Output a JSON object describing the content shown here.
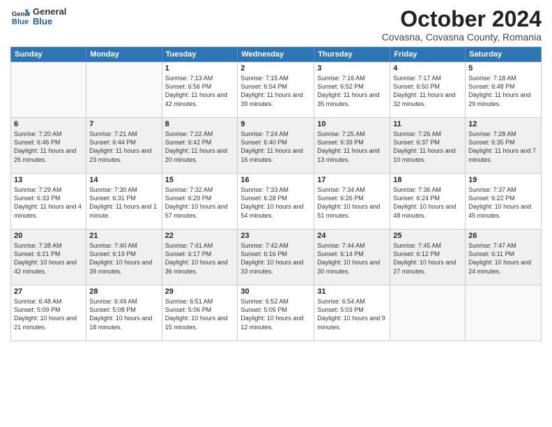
{
  "header": {
    "logo_general": "General",
    "logo_blue": "Blue",
    "month_title": "October 2024",
    "location": "Covasna, Covasna County, Romania"
  },
  "weekdays": [
    "Sunday",
    "Monday",
    "Tuesday",
    "Wednesday",
    "Thursday",
    "Friday",
    "Saturday"
  ],
  "weeks": [
    [
      {
        "day": "",
        "sunrise": "",
        "sunset": "",
        "daylight": ""
      },
      {
        "day": "",
        "sunrise": "",
        "sunset": "",
        "daylight": ""
      },
      {
        "day": "1",
        "sunrise": "Sunrise: 7:13 AM",
        "sunset": "Sunset: 6:56 PM",
        "daylight": "Daylight: 11 hours and 42 minutes."
      },
      {
        "day": "2",
        "sunrise": "Sunrise: 7:15 AM",
        "sunset": "Sunset: 6:54 PM",
        "daylight": "Daylight: 11 hours and 39 minutes."
      },
      {
        "day": "3",
        "sunrise": "Sunrise: 7:16 AM",
        "sunset": "Sunset: 6:52 PM",
        "daylight": "Daylight: 11 hours and 35 minutes."
      },
      {
        "day": "4",
        "sunrise": "Sunrise: 7:17 AM",
        "sunset": "Sunset: 6:50 PM",
        "daylight": "Daylight: 11 hours and 32 minutes."
      },
      {
        "day": "5",
        "sunrise": "Sunrise: 7:18 AM",
        "sunset": "Sunset: 6:48 PM",
        "daylight": "Daylight: 11 hours and 29 minutes."
      }
    ],
    [
      {
        "day": "6",
        "sunrise": "Sunrise: 7:20 AM",
        "sunset": "Sunset: 6:46 PM",
        "daylight": "Daylight: 11 hours and 26 minutes."
      },
      {
        "day": "7",
        "sunrise": "Sunrise: 7:21 AM",
        "sunset": "Sunset: 6:44 PM",
        "daylight": "Daylight: 11 hours and 23 minutes."
      },
      {
        "day": "8",
        "sunrise": "Sunrise: 7:22 AM",
        "sunset": "Sunset: 6:42 PM",
        "daylight": "Daylight: 11 hours and 20 minutes."
      },
      {
        "day": "9",
        "sunrise": "Sunrise: 7:24 AM",
        "sunset": "Sunset: 6:40 PM",
        "daylight": "Daylight: 11 hours and 16 minutes."
      },
      {
        "day": "10",
        "sunrise": "Sunrise: 7:25 AM",
        "sunset": "Sunset: 6:39 PM",
        "daylight": "Daylight: 11 hours and 13 minutes."
      },
      {
        "day": "11",
        "sunrise": "Sunrise: 7:26 AM",
        "sunset": "Sunset: 6:37 PM",
        "daylight": "Daylight: 11 hours and 10 minutes."
      },
      {
        "day": "12",
        "sunrise": "Sunrise: 7:28 AM",
        "sunset": "Sunset: 6:35 PM",
        "daylight": "Daylight: 11 hours and 7 minutes."
      }
    ],
    [
      {
        "day": "13",
        "sunrise": "Sunrise: 7:29 AM",
        "sunset": "Sunset: 6:33 PM",
        "daylight": "Daylight: 11 hours and 4 minutes."
      },
      {
        "day": "14",
        "sunrise": "Sunrise: 7:30 AM",
        "sunset": "Sunset: 6:31 PM",
        "daylight": "Daylight: 11 hours and 1 minute."
      },
      {
        "day": "15",
        "sunrise": "Sunrise: 7:32 AM",
        "sunset": "Sunset: 6:29 PM",
        "daylight": "Daylight: 10 hours and 57 minutes."
      },
      {
        "day": "16",
        "sunrise": "Sunrise: 7:33 AM",
        "sunset": "Sunset: 6:28 PM",
        "daylight": "Daylight: 10 hours and 54 minutes."
      },
      {
        "day": "17",
        "sunrise": "Sunrise: 7:34 AM",
        "sunset": "Sunset: 6:26 PM",
        "daylight": "Daylight: 10 hours and 51 minutes."
      },
      {
        "day": "18",
        "sunrise": "Sunrise: 7:36 AM",
        "sunset": "Sunset: 6:24 PM",
        "daylight": "Daylight: 10 hours and 48 minutes."
      },
      {
        "day": "19",
        "sunrise": "Sunrise: 7:37 AM",
        "sunset": "Sunset: 6:22 PM",
        "daylight": "Daylight: 10 hours and 45 minutes."
      }
    ],
    [
      {
        "day": "20",
        "sunrise": "Sunrise: 7:38 AM",
        "sunset": "Sunset: 6:21 PM",
        "daylight": "Daylight: 10 hours and 42 minutes."
      },
      {
        "day": "21",
        "sunrise": "Sunrise: 7:40 AM",
        "sunset": "Sunset: 6:19 PM",
        "daylight": "Daylight: 10 hours and 39 minutes."
      },
      {
        "day": "22",
        "sunrise": "Sunrise: 7:41 AM",
        "sunset": "Sunset: 6:17 PM",
        "daylight": "Daylight: 10 hours and 36 minutes."
      },
      {
        "day": "23",
        "sunrise": "Sunrise: 7:42 AM",
        "sunset": "Sunset: 6:16 PM",
        "daylight": "Daylight: 10 hours and 33 minutes."
      },
      {
        "day": "24",
        "sunrise": "Sunrise: 7:44 AM",
        "sunset": "Sunset: 6:14 PM",
        "daylight": "Daylight: 10 hours and 30 minutes."
      },
      {
        "day": "25",
        "sunrise": "Sunrise: 7:45 AM",
        "sunset": "Sunset: 6:12 PM",
        "daylight": "Daylight: 10 hours and 27 minutes."
      },
      {
        "day": "26",
        "sunrise": "Sunrise: 7:47 AM",
        "sunset": "Sunset: 6:11 PM",
        "daylight": "Daylight: 10 hours and 24 minutes."
      }
    ],
    [
      {
        "day": "27",
        "sunrise": "Sunrise: 6:48 AM",
        "sunset": "Sunset: 5:09 PM",
        "daylight": "Daylight: 10 hours and 21 minutes."
      },
      {
        "day": "28",
        "sunrise": "Sunrise: 6:49 AM",
        "sunset": "Sunset: 5:08 PM",
        "daylight": "Daylight: 10 hours and 18 minutes."
      },
      {
        "day": "29",
        "sunrise": "Sunrise: 6:51 AM",
        "sunset": "Sunset: 5:06 PM",
        "daylight": "Daylight: 10 hours and 15 minutes."
      },
      {
        "day": "30",
        "sunrise": "Sunrise: 6:52 AM",
        "sunset": "Sunset: 5:05 PM",
        "daylight": "Daylight: 10 hours and 12 minutes."
      },
      {
        "day": "31",
        "sunrise": "Sunrise: 6:54 AM",
        "sunset": "Sunset: 5:03 PM",
        "daylight": "Daylight: 10 hours and 9 minutes."
      },
      {
        "day": "",
        "sunrise": "",
        "sunset": "",
        "daylight": ""
      },
      {
        "day": "",
        "sunrise": "",
        "sunset": "",
        "daylight": ""
      }
    ]
  ]
}
